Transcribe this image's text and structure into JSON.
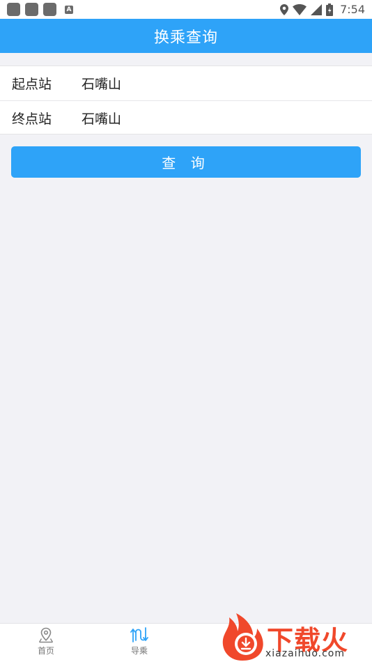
{
  "status_bar": {
    "time": "7:54",
    "notification_badge": "A"
  },
  "header": {
    "title": "换乘查询"
  },
  "form": {
    "start": {
      "label": "起点站",
      "value": "石嘴山"
    },
    "end": {
      "label": "终点站",
      "value": "石嘴山"
    }
  },
  "actions": {
    "query_label": "查 询"
  },
  "bottom_nav": {
    "items": [
      {
        "label": "首页",
        "icon": "location-pin-icon"
      },
      {
        "label": "导乘",
        "icon": "route-icon"
      }
    ]
  },
  "watermark": {
    "brand": "下载火",
    "url": "xiazaihuo.com"
  },
  "colors": {
    "accent": "#2ea3f8",
    "background": "#f2f2f6",
    "watermark": "#f0482b"
  }
}
